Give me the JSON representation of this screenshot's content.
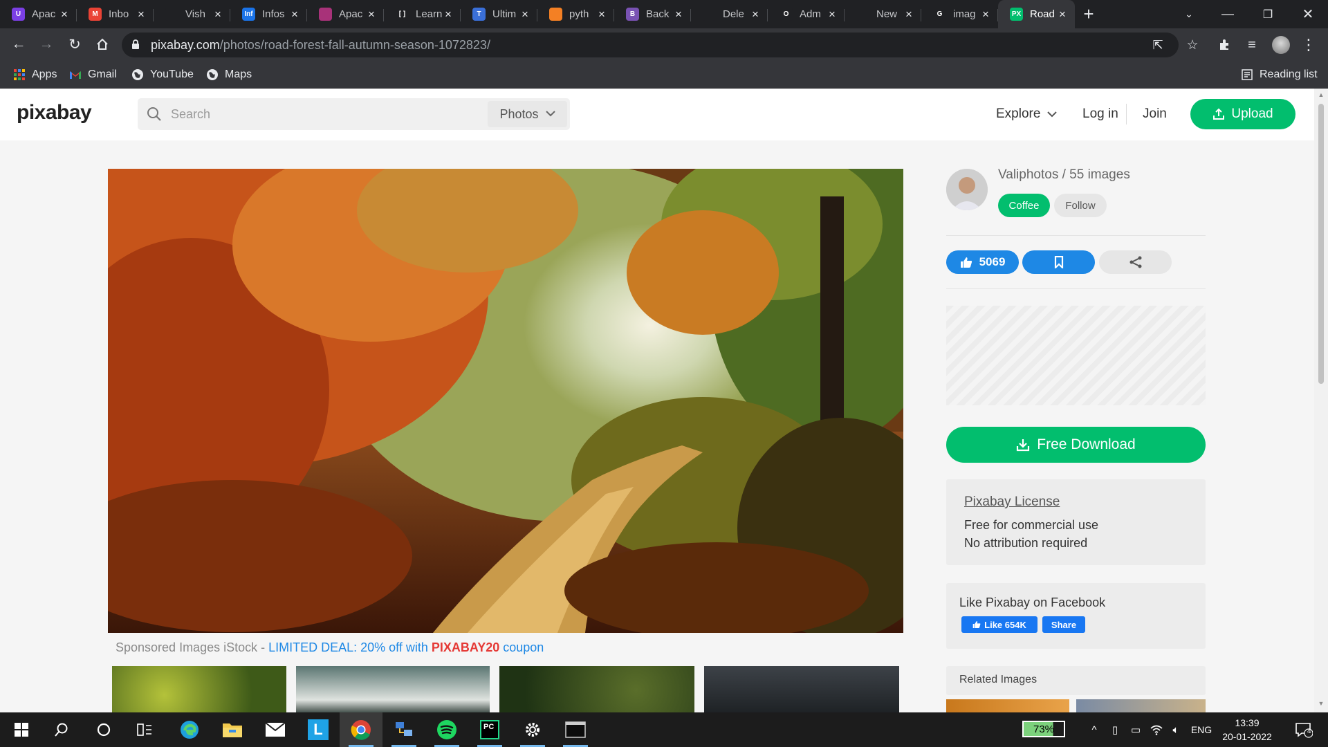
{
  "tabs": [
    {
      "title": "Apac",
      "favicon": "u-purple-icon",
      "color": "#7b3fe4",
      "glyph": "U"
    },
    {
      "title": "Inbo",
      "favicon": "gmail-icon",
      "color": "#ea4335",
      "glyph": "M"
    },
    {
      "title": "Vish",
      "favicon": "github-icon",
      "color": "#202124",
      "glyph": ""
    },
    {
      "title": "Infos",
      "favicon": "infosys-icon",
      "color": "#1a73e8",
      "glyph": "Inf"
    },
    {
      "title": "Apac",
      "favicon": "feather-icon",
      "color": "#a83279",
      "glyph": ""
    },
    {
      "title": "Learn",
      "favicon": "brackets-icon",
      "color": "#202124",
      "glyph": "[ ]"
    },
    {
      "title": "Ultim",
      "favicon": "tata-icon",
      "color": "#3a6fd8",
      "glyph": "T"
    },
    {
      "title": "pyth",
      "favicon": "stackoverflow-icon",
      "color": "#f48024",
      "glyph": ""
    },
    {
      "title": "Back",
      "favicon": "bootstrap-icon",
      "color": "#7952b3",
      "glyph": "B"
    },
    {
      "title": "Dele",
      "favicon": "github-icon",
      "color": "#202124",
      "glyph": ""
    },
    {
      "title": "Adm",
      "favicon": "opera-icon",
      "color": "#202124",
      "glyph": "O"
    },
    {
      "title": "New",
      "favicon": "chrome-icon",
      "color": "#202124",
      "glyph": ""
    },
    {
      "title": "imag",
      "favicon": "google-icon",
      "color": "#202124",
      "glyph": "G"
    },
    {
      "title": "Road",
      "favicon": "pixabay-icon",
      "color": "#02be6e",
      "glyph": "PX",
      "active": true
    }
  ],
  "url": {
    "host": "pixabay.com",
    "path": "/photos/road-forest-fall-autumn-season-1072823/"
  },
  "bookmarks": {
    "apps": "Apps",
    "gmail": "Gmail",
    "youtube": "YouTube",
    "maps": "Maps",
    "reading_list": "Reading list"
  },
  "header": {
    "logo": "pixabay",
    "search_placeholder": "Search",
    "media_type": "Photos",
    "explore": "Explore",
    "login": "Log in",
    "join": "Join",
    "upload": "Upload"
  },
  "sponsored": {
    "prefix": "Sponsored Images iStock - ",
    "deal": "LIMITED DEAL: 20% off with ",
    "code": "PIXABAY20",
    "suffix": " coupon"
  },
  "author": {
    "line": "Valiphotos / 55 images",
    "coffee": "Coffee",
    "follow": "Follow"
  },
  "actions": {
    "likes": "5069"
  },
  "download": {
    "label": "Free Download"
  },
  "license": {
    "title": "Pixabay License",
    "line1": "Free for commercial use",
    "line2": "No attribution required"
  },
  "facebook": {
    "title": "Like Pixabay on Facebook",
    "like": "Like 654K",
    "share": "Share"
  },
  "related": {
    "title": "Related Images"
  },
  "taskbar": {
    "battery": "73%",
    "language": "ENG",
    "time": "13:39",
    "date": "20-01-2022",
    "notifications": "4"
  },
  "colors": {
    "brand_green": "#02be6e",
    "action_blue": "#1e88e5",
    "facebook_blue": "#1877f2"
  }
}
